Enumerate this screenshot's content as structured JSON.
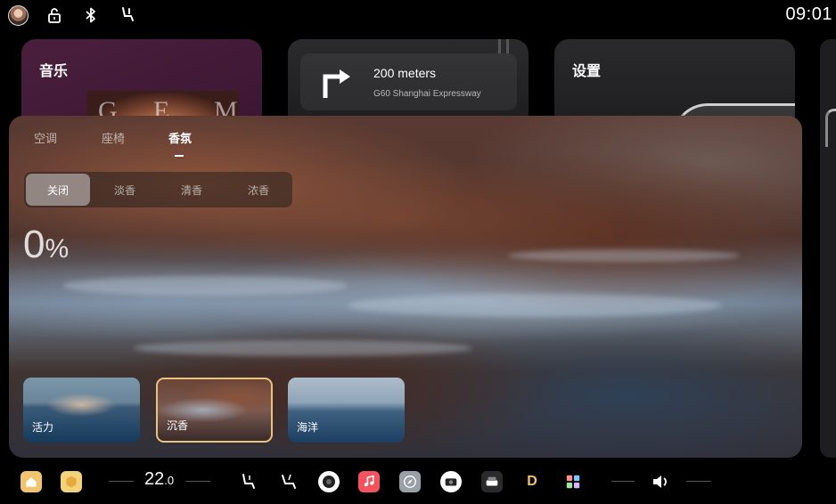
{
  "status": {
    "time": "09:01",
    "icons": [
      "avatar",
      "unlock-icon",
      "bluetooth-icon",
      "seat-icon"
    ]
  },
  "cards": {
    "music": {
      "title": "音乐",
      "album_letters": [
        "G",
        "E",
        "M"
      ]
    },
    "navigation": {
      "distance": "200 meters",
      "road": "G60 Shanghai Expressway",
      "turn": "turn-right-icon"
    },
    "settings": {
      "title": "设置"
    }
  },
  "panel": {
    "tabs": [
      {
        "label": "空调"
      },
      {
        "label": "座椅"
      },
      {
        "label": "香氛",
        "active": true
      }
    ],
    "intensity_options": [
      {
        "label": "关闭",
        "selected": true
      },
      {
        "label": "淡香"
      },
      {
        "label": "清香"
      },
      {
        "label": "浓香"
      }
    ],
    "level_value": "0",
    "level_unit": "%",
    "scenes": [
      {
        "label": "活力"
      },
      {
        "label": "沉香",
        "selected": true
      },
      {
        "label": "海洋"
      }
    ],
    "accent_color": "#e8c27f"
  },
  "dock": {
    "temperature_int": "22",
    "temperature_dec": ".0",
    "apps": [
      "home-icon",
      "box-icon",
      "seat-heat-icon",
      "seat-recline-icon",
      "camera-icon",
      "music-app-icon",
      "compass-icon",
      "media-icon",
      "car-icon",
      "d-icon",
      "apps-grid-icon",
      "volume-icon"
    ]
  }
}
